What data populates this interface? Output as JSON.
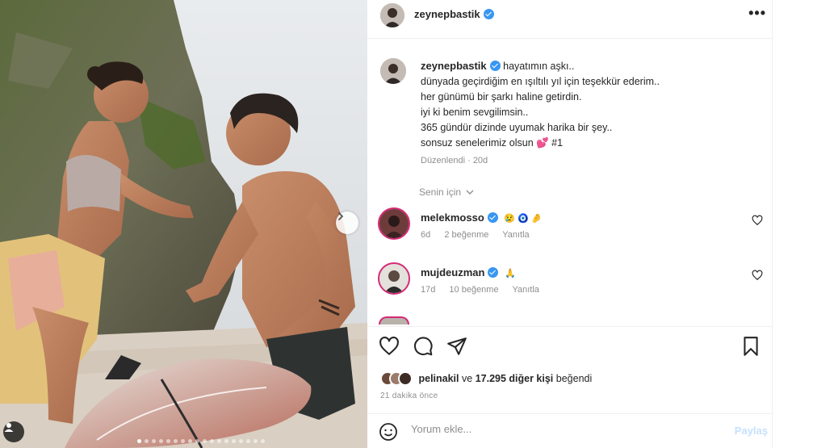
{
  "post": {
    "username": "zeynepbastik",
    "caption_lines": [
      "hayatımın aşkı..",
      "dünyada geçirdiğim en ışıltılı yıl için teşekkür ederim..",
      "her günümü bir şarkı haline getirdin.",
      "iyi ki benim sevgilimsin..",
      "365 gündür dizinde uyumak harika bir şey..",
      "sonsuz senelerimiz olsun 💕 #1"
    ],
    "caption_meta": "Düzenlendi · 20d",
    "more_icon": "•••"
  },
  "filter": {
    "label": "Senin için",
    "icon": "chevron-down-icon"
  },
  "comments": [
    {
      "username": "melekmosso",
      "emojis": "😢 🧿 🤌",
      "age": "6d",
      "likes": "2 beğenme",
      "reply": "Yanıtla"
    },
    {
      "username": "mujdeuzman",
      "emojis": "🙏",
      "age": "17d",
      "likes": "10 beğenme",
      "reply": "Yanıtla"
    }
  ],
  "likes": {
    "first_user": "pelinakil",
    "connector": "ve",
    "others": "17.295 diğer kişi",
    "suffix": "beğendi"
  },
  "time_ago": "21 dakika önce",
  "comment_box": {
    "placeholder": "Yorum ekle...",
    "post_label": "Paylaş"
  },
  "colors": {
    "link_blue": "#3897f0",
    "muted": "#8e8e8e",
    "text": "#262626"
  },
  "icons": [
    "heart-icon",
    "comment-icon",
    "share-icon",
    "bookmark-icon",
    "smile-icon",
    "chevron-right-icon",
    "user-tag-icon"
  ]
}
